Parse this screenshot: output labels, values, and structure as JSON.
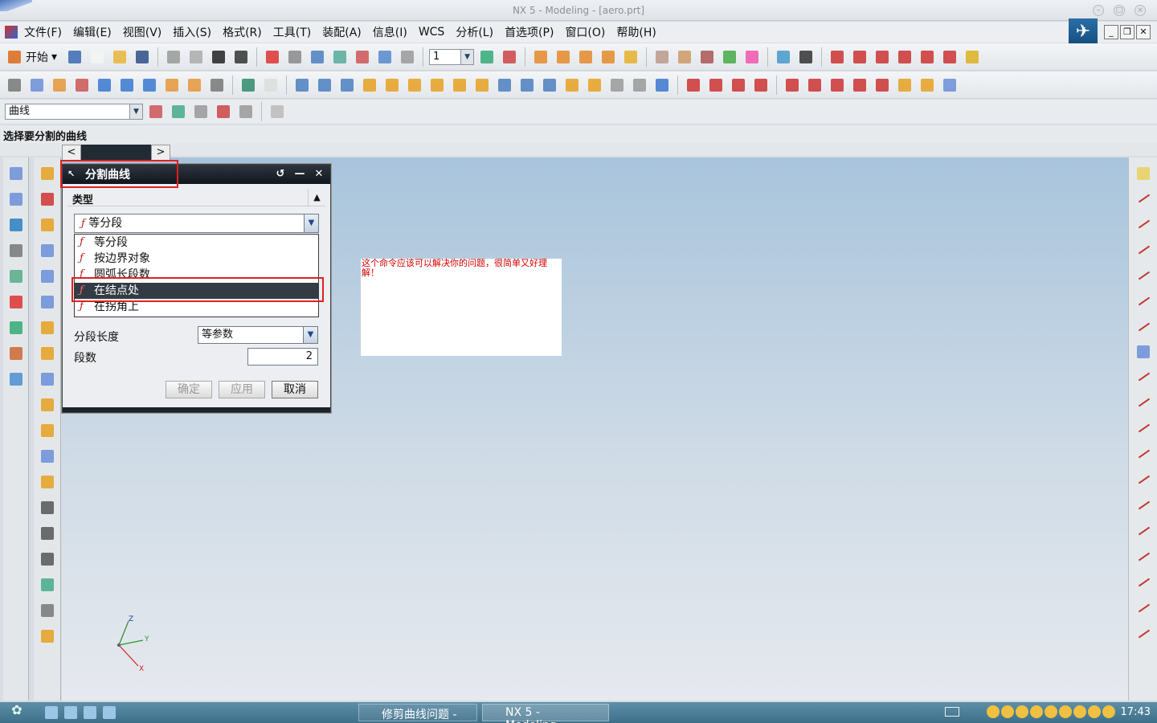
{
  "window": {
    "title": "NX 5 - Modeling - [aero.prt]"
  },
  "menu": {
    "items": [
      "文件(F)",
      "编辑(E)",
      "视图(V)",
      "插入(S)",
      "格式(R)",
      "工具(T)",
      "装配(A)",
      "信息(I)",
      "WCS",
      "分析(L)",
      "首选项(P)",
      "窗口(O)",
      "帮助(H)"
    ]
  },
  "toolbar": {
    "start_label": "开始",
    "layer_value": "1"
  },
  "selection_filter": {
    "value": "曲线"
  },
  "prompt": {
    "text": "选择要分割的曲线"
  },
  "dialog": {
    "title": "分割曲线",
    "section_label": "类型",
    "type_selected": "等分段",
    "options": [
      "等分段",
      "按边界对象",
      "圆弧长段数",
      "在结点处",
      "在拐角上"
    ],
    "highlighted_option": "在结点处",
    "segment_length_label": "分段长度",
    "segment_length_value": "等参数",
    "segments_label": "段数",
    "segments_value": "2",
    "ok_label": "确定",
    "apply_label": "应用",
    "cancel_label": "取消"
  },
  "note": {
    "text": "这个命令应该可以解决你的问题，很简单又好理解！"
  },
  "triad": {
    "x": "X",
    "y": "Y",
    "z": "Z"
  },
  "taskbar": {
    "task1": "修剪曲线问题 - ...",
    "task2": "NX 5 - Modeling...",
    "clock": "17:43"
  },
  "colors": {
    "highlight": "#e02020",
    "note_text": "#d40000",
    "dialog_title_bg": "#1b232c"
  }
}
